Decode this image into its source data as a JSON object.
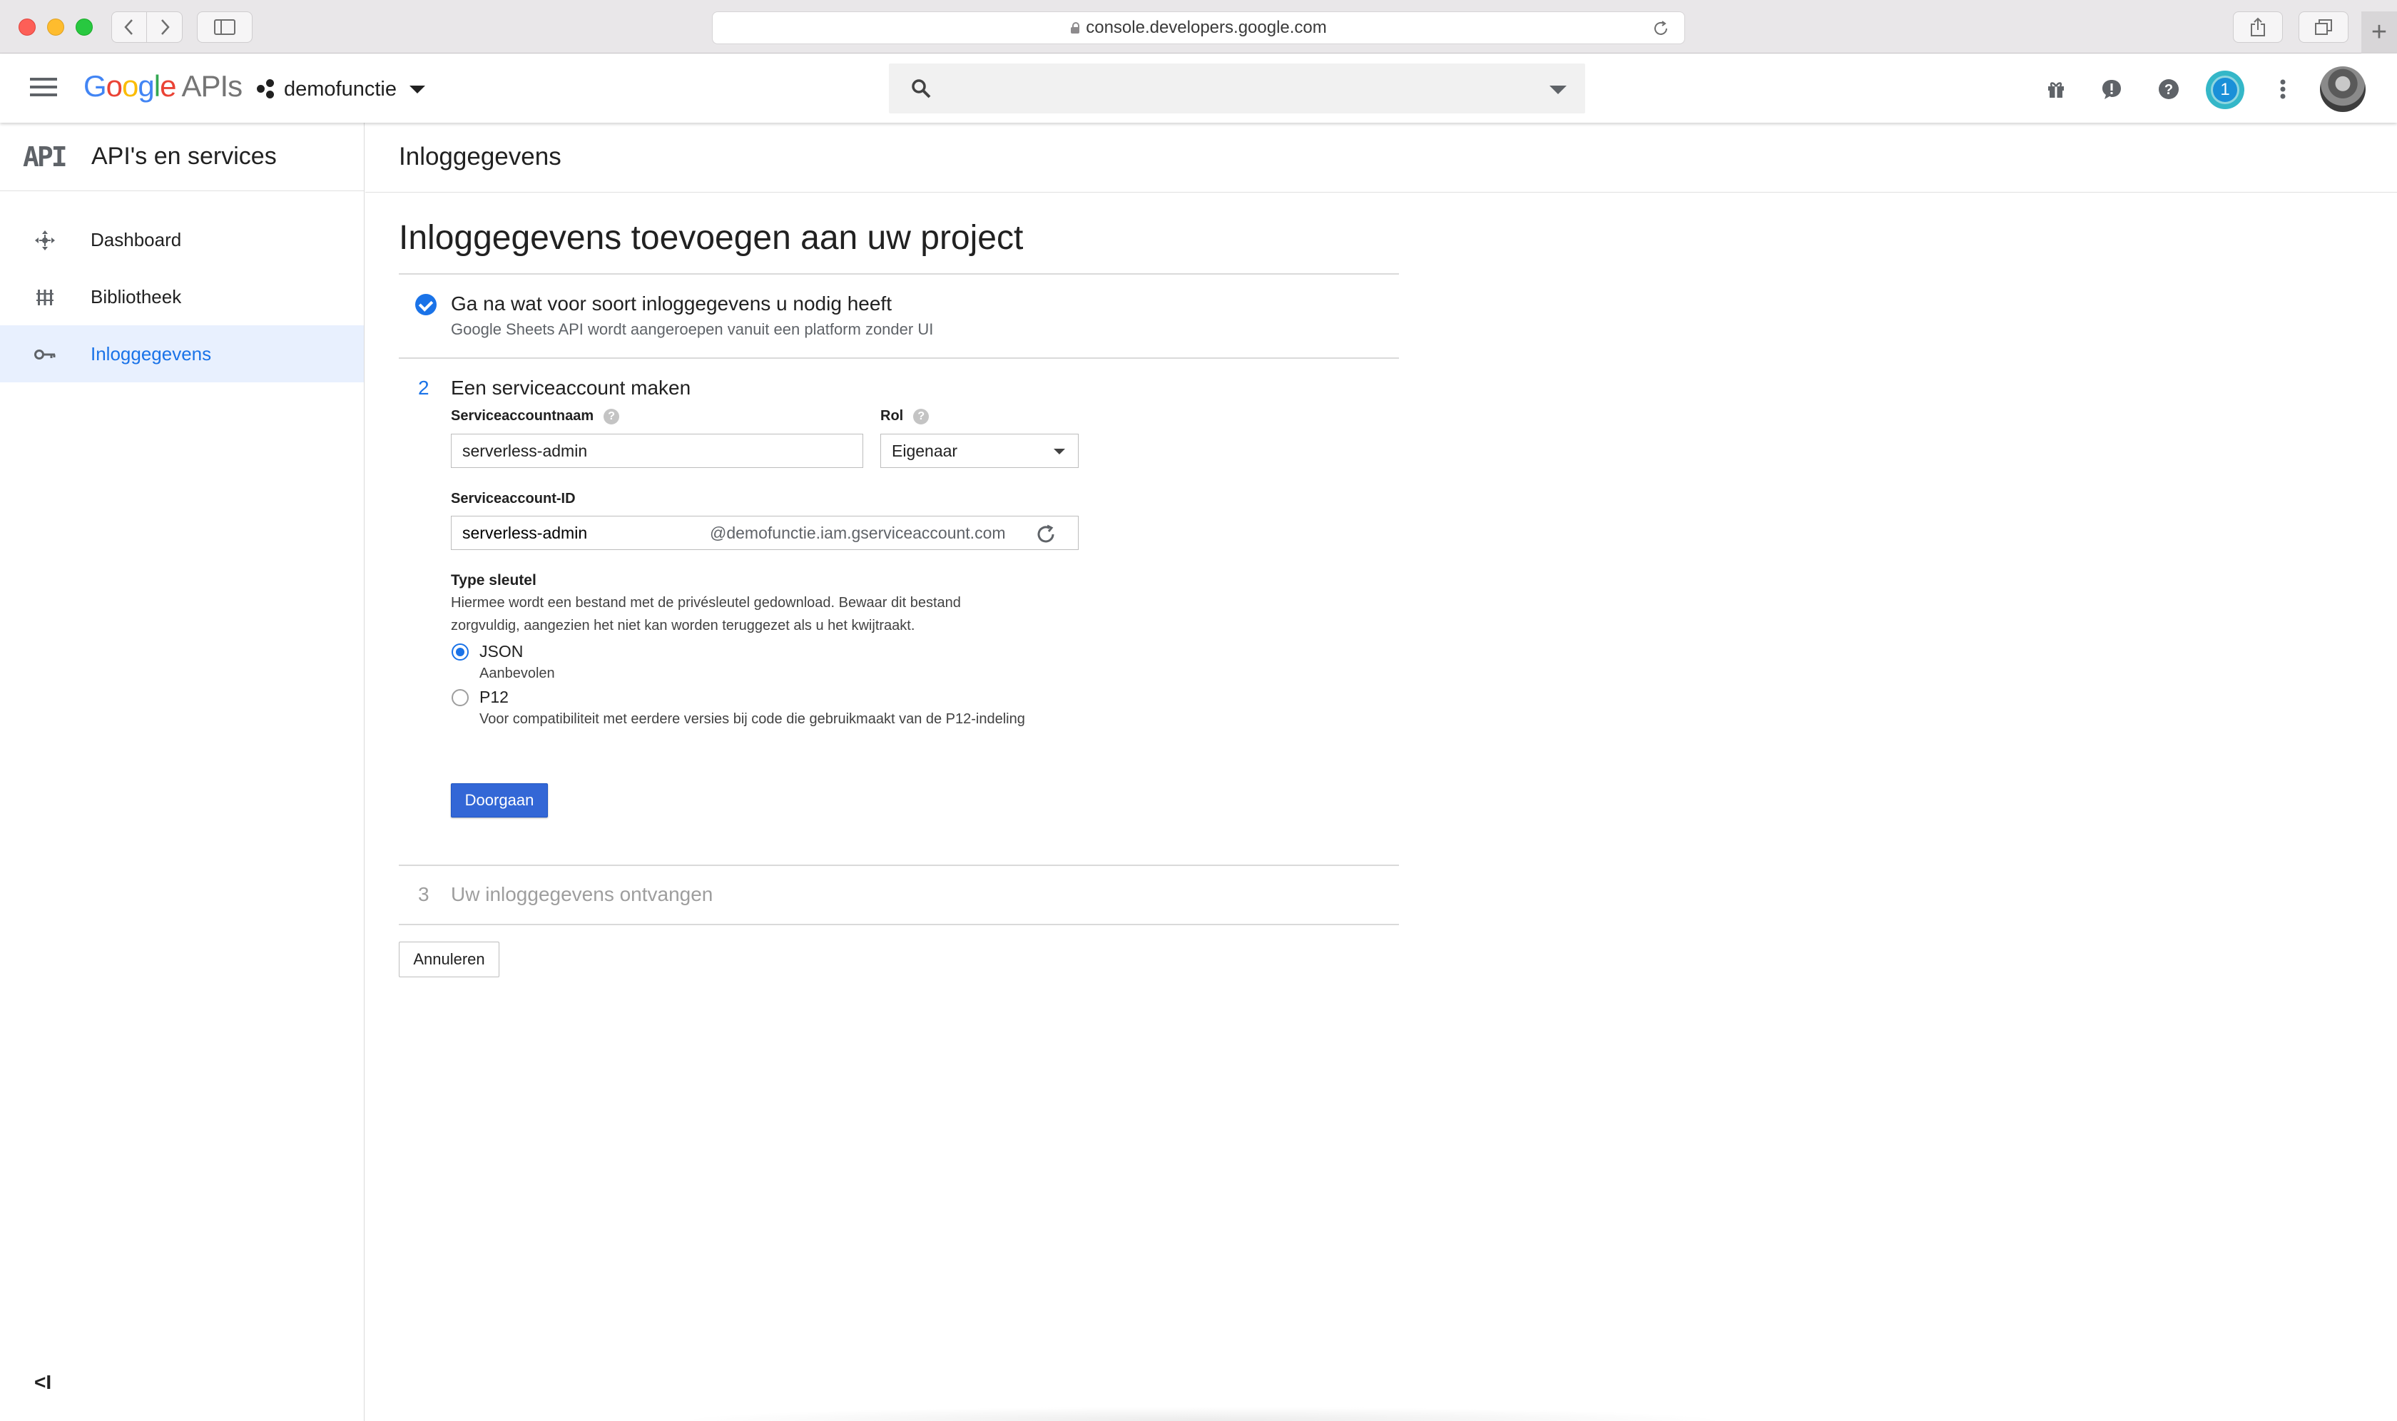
{
  "browser": {
    "url": "console.developers.google.com"
  },
  "topbar": {
    "logo_google": "Google",
    "logo_apis": "APIs",
    "project_name": "demofunctie",
    "search_placeholder": "",
    "notification_count": "1",
    "brand_colors": {
      "blue": "#4285f4",
      "red": "#ea4335",
      "yellow": "#fbbc05",
      "green": "#34a853"
    }
  },
  "sidebar": {
    "logo": "API",
    "title": "API's en services",
    "items": [
      {
        "label": "Dashboard",
        "icon": "dashboard-icon",
        "active": false
      },
      {
        "label": "Bibliotheek",
        "icon": "library-icon",
        "active": false
      },
      {
        "label": "Inloggegevens",
        "icon": "key-icon",
        "active": true
      }
    ],
    "collapse_label": "<I"
  },
  "main": {
    "header_title": "Inloggegevens",
    "page_title": "Inloggegevens toevoegen aan uw project",
    "step1": {
      "title": "Ga na wat voor soort inloggegevens u nodig heeft",
      "subtitle": "Google Sheets API wordt aangeroepen vanuit een platform zonder UI"
    },
    "step2": {
      "number": "2",
      "title": "Een serviceaccount maken",
      "name_label": "Serviceaccountnaam",
      "name_value": "serverless-admin",
      "role_label": "Rol",
      "role_value": "Eigenaar",
      "id_label": "Serviceaccount-ID",
      "id_value": "serverless-admin",
      "id_suffix": "@demofunctie.iam.gserviceaccount.com",
      "keytype_title": "Type sleutel",
      "keytype_desc": "Hiermee wordt een bestand met de privésleutel gedownload. Bewaar dit bestand zorgvuldig, aangezien het niet kan worden teruggezet als u het kwijtraakt.",
      "options": [
        {
          "label": "JSON",
          "sub": "Aanbevolen",
          "selected": true
        },
        {
          "label": "P12",
          "sub": "Voor compatibiliteit met eerdere versies bij code die gebruikmaakt van de P12-indeling",
          "selected": false
        }
      ],
      "continue_label": "Doorgaan"
    },
    "step3": {
      "number": "3",
      "title": "Uw inloggegevens ontvangen"
    },
    "cancel_label": "Annuleren"
  }
}
